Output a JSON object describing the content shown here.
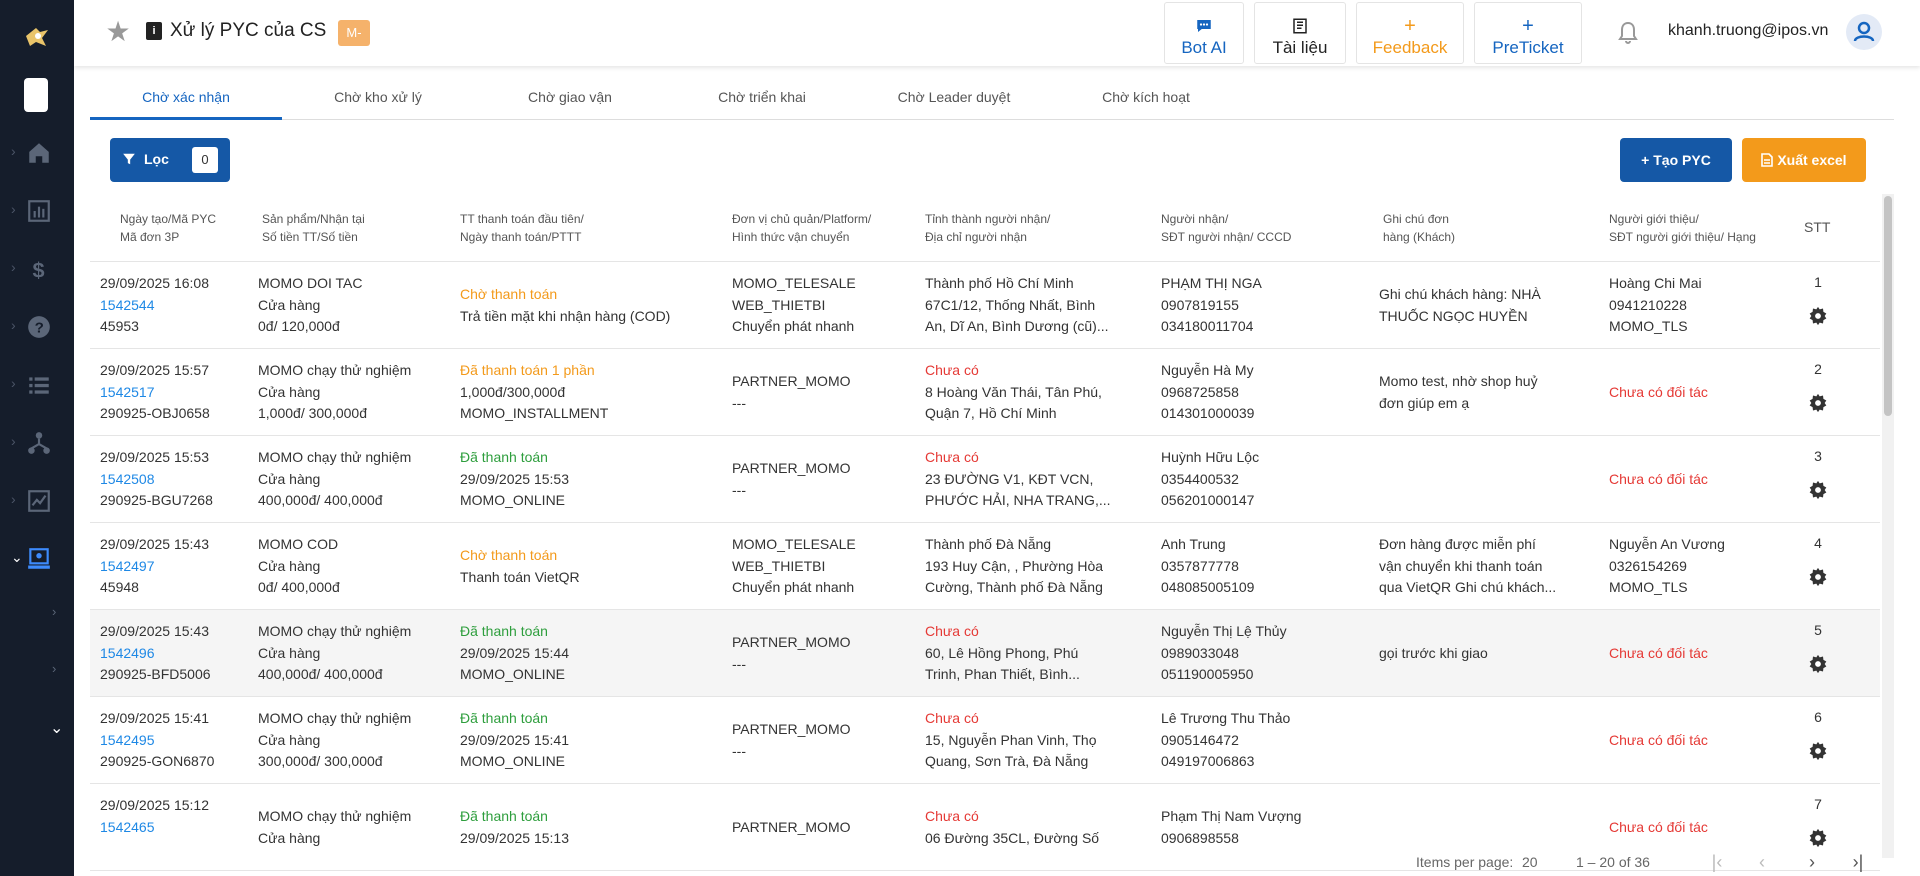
{
  "header": {
    "title": "Xử lý PYC của CS",
    "badge": "M-",
    "buttons": {
      "bot_ai": "Bot AI",
      "tai_lieu": "Tài liệu",
      "feedback": "Feedback",
      "preticket": "PreTicket"
    },
    "user_email": "khanh.truong@ipos.vn"
  },
  "tabs": [
    "Chờ xác nhận",
    "Chờ kho xử lý",
    "Chờ giao vận",
    "Chờ triển khai",
    "Chờ Leader duyệt",
    "Chờ kích hoạt"
  ],
  "toolbar": {
    "filter_label": "Lọc",
    "filter_count": "0",
    "create_label": "Tạo PYC",
    "export_label": "Xuất excel"
  },
  "columns": [
    [
      "Ngày tạo/Mã PYC",
      "Mã đơn 3P"
    ],
    [
      "Sản phẩm/Nhận tại",
      "Số tiền TT/Số tiền"
    ],
    [
      "TT thanh toán đầu tiên/",
      "Ngày thanh toán/PTTT"
    ],
    [
      "Đơn vị chủ quản/Platform/",
      "Hình thức vận chuyển"
    ],
    [
      "Tỉnh thành người nhận/",
      "Địa chỉ người nhận"
    ],
    [
      "Người nhận/",
      "SĐT người nhận/ CCCD"
    ],
    [
      "Ghi chú đơn",
      "hàng (Khách)"
    ],
    [
      "Người giới thiệu/",
      "SĐT người giới thiệu/ Hạng"
    ],
    [
      "STT"
    ]
  ],
  "rows": [
    {
      "c1": [
        "29/09/2025 16:08",
        "1542544",
        "45953"
      ],
      "c2": [
        "MOMO DOI TAC",
        "Cửa hàng",
        "0đ/ 120,000đ"
      ],
      "c3": [
        "Chờ thanh toán",
        "Trả tiền mặt khi nhận hàng (COD)"
      ],
      "c3_status": "orange",
      "c4": [
        "MOMO_TELESALE",
        "WEB_THIETBI",
        "Chuyển phát nhanh"
      ],
      "c5": [
        "Thành phố Hồ Chí Minh",
        "67C1/12, Thống Nhất, Bình",
        "An, Dĩ An, Bình Dương (cũ)..."
      ],
      "c5_red": false,
      "c6": [
        "PHẠM THỊ NGA",
        "0907819155",
        "034180011704"
      ],
      "c7": [
        "Ghi chú khách hàng: NHÀ",
        "THUỐC NGỌC HUYỀN"
      ],
      "c8": [
        "Hoàng Chi Mai",
        "0941210228",
        "MOMO_TLS"
      ],
      "c8_red": false,
      "stt": "1"
    },
    {
      "c1": [
        "29/09/2025 15:57",
        "1542517",
        "290925-OBJ0658"
      ],
      "c2": [
        "MOMO chạy thử nghiệm",
        "Cửa hàng",
        "1,000đ/ 300,000đ"
      ],
      "c3": [
        "Đã thanh toán 1 phần",
        "1,000đ/300,000đ",
        "MOMO_INSTALLMENT"
      ],
      "c3_status": "orange",
      "c4": [
        "PARTNER_MOMO",
        "---"
      ],
      "c5": [
        "Chưa có",
        "8 Hoàng Văn Thái, Tân Phú,",
        "Quận 7, Hồ Chí Minh"
      ],
      "c5_red": true,
      "c6": [
        "Nguyễn Hà My",
        "0968725858",
        "014301000039"
      ],
      "c7": [
        "Momo test, nhờ shop huỷ",
        "đơn giúp em ạ"
      ],
      "c8": [
        "Chưa có đối tác"
      ],
      "c8_red": true,
      "stt": "2"
    },
    {
      "c1": [
        "29/09/2025 15:53",
        "1542508",
        "290925-BGU7268"
      ],
      "c2": [
        "MOMO chạy thử nghiệm",
        "Cửa hàng",
        "400,000đ/ 400,000đ"
      ],
      "c3": [
        "Đã thanh toán",
        "29/09/2025 15:53",
        "MOMO_ONLINE"
      ],
      "c3_status": "green",
      "c4": [
        "PARTNER_MOMO",
        "---"
      ],
      "c5": [
        "Chưa có",
        "23 ĐƯỜNG V1, KĐT VCN,",
        "PHƯỚC HẢI, NHA TRANG,..."
      ],
      "c5_red": true,
      "c6": [
        "Huỳnh Hữu Lộc",
        "0354400532",
        "056201000147"
      ],
      "c7": [],
      "c8": [
        "Chưa có đối tác"
      ],
      "c8_red": true,
      "stt": "3"
    },
    {
      "c1": [
        "29/09/2025 15:43",
        "1542497",
        "45948"
      ],
      "c2": [
        "MOMO COD",
        "Cửa hàng",
        "0đ/ 400,000đ"
      ],
      "c3": [
        "Chờ thanh toán",
        "Thanh toán VietQR"
      ],
      "c3_status": "orange",
      "c4": [
        "MOMO_TELESALE",
        "WEB_THIETBI",
        "Chuyển phát nhanh"
      ],
      "c5": [
        "Thành phố Đà Nẵng",
        "193 Huy Cận, , Phường Hòa",
        "Cường, Thành phố Đà Nẵng"
      ],
      "c5_red": false,
      "c6": [
        "Anh Trung",
        "0357877778",
        "048085005109"
      ],
      "c7": [
        "Đơn hàng được miễn phí",
        "vận chuyển khi thanh toán",
        "qua VietQR Ghi chú khách..."
      ],
      "c8": [
        "Nguyễn An Vương",
        "0326154269",
        "MOMO_TLS"
      ],
      "c8_red": false,
      "stt": "4"
    },
    {
      "c1": [
        "29/09/2025 15:43",
        "1542496",
        "290925-BFD5006"
      ],
      "c2": [
        "MOMO chạy thử nghiệm",
        "Cửa hàng",
        "400,000đ/ 400,000đ"
      ],
      "c3": [
        "Đã thanh toán",
        "29/09/2025 15:44",
        "MOMO_ONLINE"
      ],
      "c3_status": "green",
      "c4": [
        "PARTNER_MOMO",
        "---"
      ],
      "c5": [
        "Chưa có",
        "60, Lê Hồng Phong, Phú",
        "Trinh, Phan Thiết, Bình..."
      ],
      "c5_red": true,
      "c6": [
        "Nguyễn Thị Lệ Thủy",
        "0989033048",
        "051190005950"
      ],
      "c7": [
        "gọi trước khi giao"
      ],
      "c8": [
        "Chưa có đối tác"
      ],
      "c8_red": true,
      "stt": "5"
    },
    {
      "c1": [
        "29/09/2025 15:41",
        "1542495",
        "290925-GON6870"
      ],
      "c2": [
        "MOMO chạy thử nghiệm",
        "Cửa hàng",
        "300,000đ/ 300,000đ"
      ],
      "c3": [
        "Đã thanh toán",
        "29/09/2025 15:41",
        "MOMO_ONLINE"
      ],
      "c3_status": "green",
      "c4": [
        "PARTNER_MOMO",
        "---"
      ],
      "c5": [
        "Chưa có",
        "15, Nguyễn Phan Vinh, Thọ",
        "Quang, Sơn Trà, Đà Nẵng"
      ],
      "c5_red": true,
      "c6": [
        "Lê Trương Thu Thảo",
        "0905146472",
        "049197006863"
      ],
      "c7": [],
      "c8": [
        "Chưa có đối tác"
      ],
      "c8_red": true,
      "stt": "6"
    },
    {
      "c1": [
        "29/09/2025 15:12",
        "1542465",
        ""
      ],
      "c2": [
        "MOMO chạy thử nghiệm",
        "Cửa hàng",
        ""
      ],
      "c3": [
        "Đã thanh toán",
        "29/09/2025 15:13",
        ""
      ],
      "c3_status": "green",
      "c4": [
        "PARTNER_MOMO",
        ""
      ],
      "c5": [
        "Chưa có",
        "06 Đường 35CL, Đường Số",
        ""
      ],
      "c5_red": true,
      "c6": [
        "Phạm Thị Nam Vượng",
        "0906898558",
        ""
      ],
      "c7": [],
      "c8": [
        "Chưa có đối tác"
      ],
      "c8_red": true,
      "stt": "7"
    }
  ],
  "pagination": {
    "items_per_page_label": "Items per page:",
    "items_per_page": "20",
    "range": "1 – 20 of 36"
  },
  "colors": {
    "primary": "#1558a6",
    "accent_orange": "#f39a1b",
    "link": "#1e88e5",
    "success": "#2e9e3d",
    "danger": "#e53935",
    "sidebar": "#151d2b"
  }
}
